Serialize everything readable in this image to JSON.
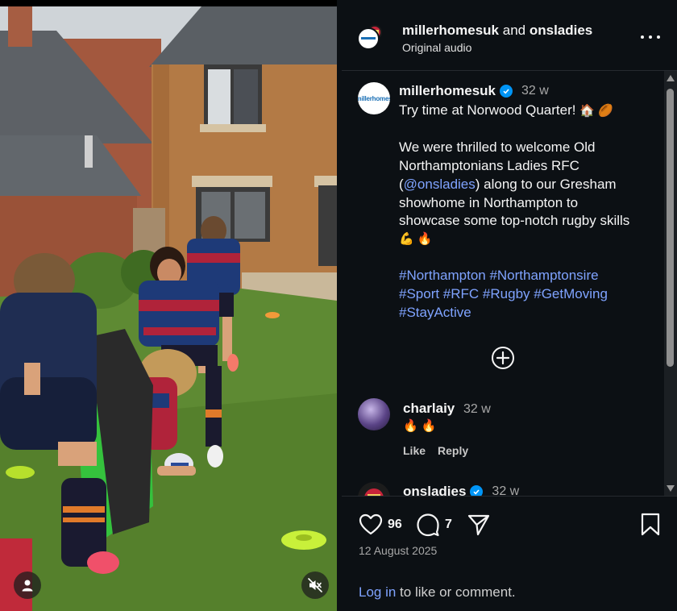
{
  "header": {
    "owner": "millerhomesuk",
    "connector": "and",
    "collaborator": "onsladies",
    "audio": "Original audio",
    "more_icon": "more-horizontal-icon"
  },
  "caption": {
    "username": "millerhomesuk",
    "time": "32 w",
    "avatar_text": "millerhomes",
    "lines": {
      "l1": "Try time at Norwood Quarter!",
      "l1_emoji": "🏠 🏉",
      "l2": "We were thrilled to welcome Old",
      "l3": "Northamptonians Ladies RFC",
      "l4_pre": "(",
      "l4_link": "@onsladies",
      "l4_post": ") along to our Gresham",
      "l5": "showhome in Northampton to",
      "l6": "showcase some top-notch rugby skills",
      "l7_emoji": "💪 🔥",
      "tags1": "#Northampton #Northamptonsire",
      "tags2": "#Sport #RFC #Rugby #GetMoving",
      "tags3": "#StayActive"
    }
  },
  "load_more_icon": "plus-circle-icon",
  "comments": [
    {
      "username": "charlaiy",
      "time": "32 w",
      "text": "🔥 🔥",
      "like": "Like",
      "reply": "Reply"
    },
    {
      "username": "onsladies",
      "time": "32 w"
    }
  ],
  "actions": {
    "likes": "96",
    "comments": "7",
    "date": "12 August 2025",
    "login_link": "Log in",
    "login_rest": " to like or comment."
  },
  "colors": {
    "panel_bg": "#0c1014",
    "link": "#7fa3ff",
    "verified": "#0095f6",
    "muted": "#a8a8a8"
  }
}
